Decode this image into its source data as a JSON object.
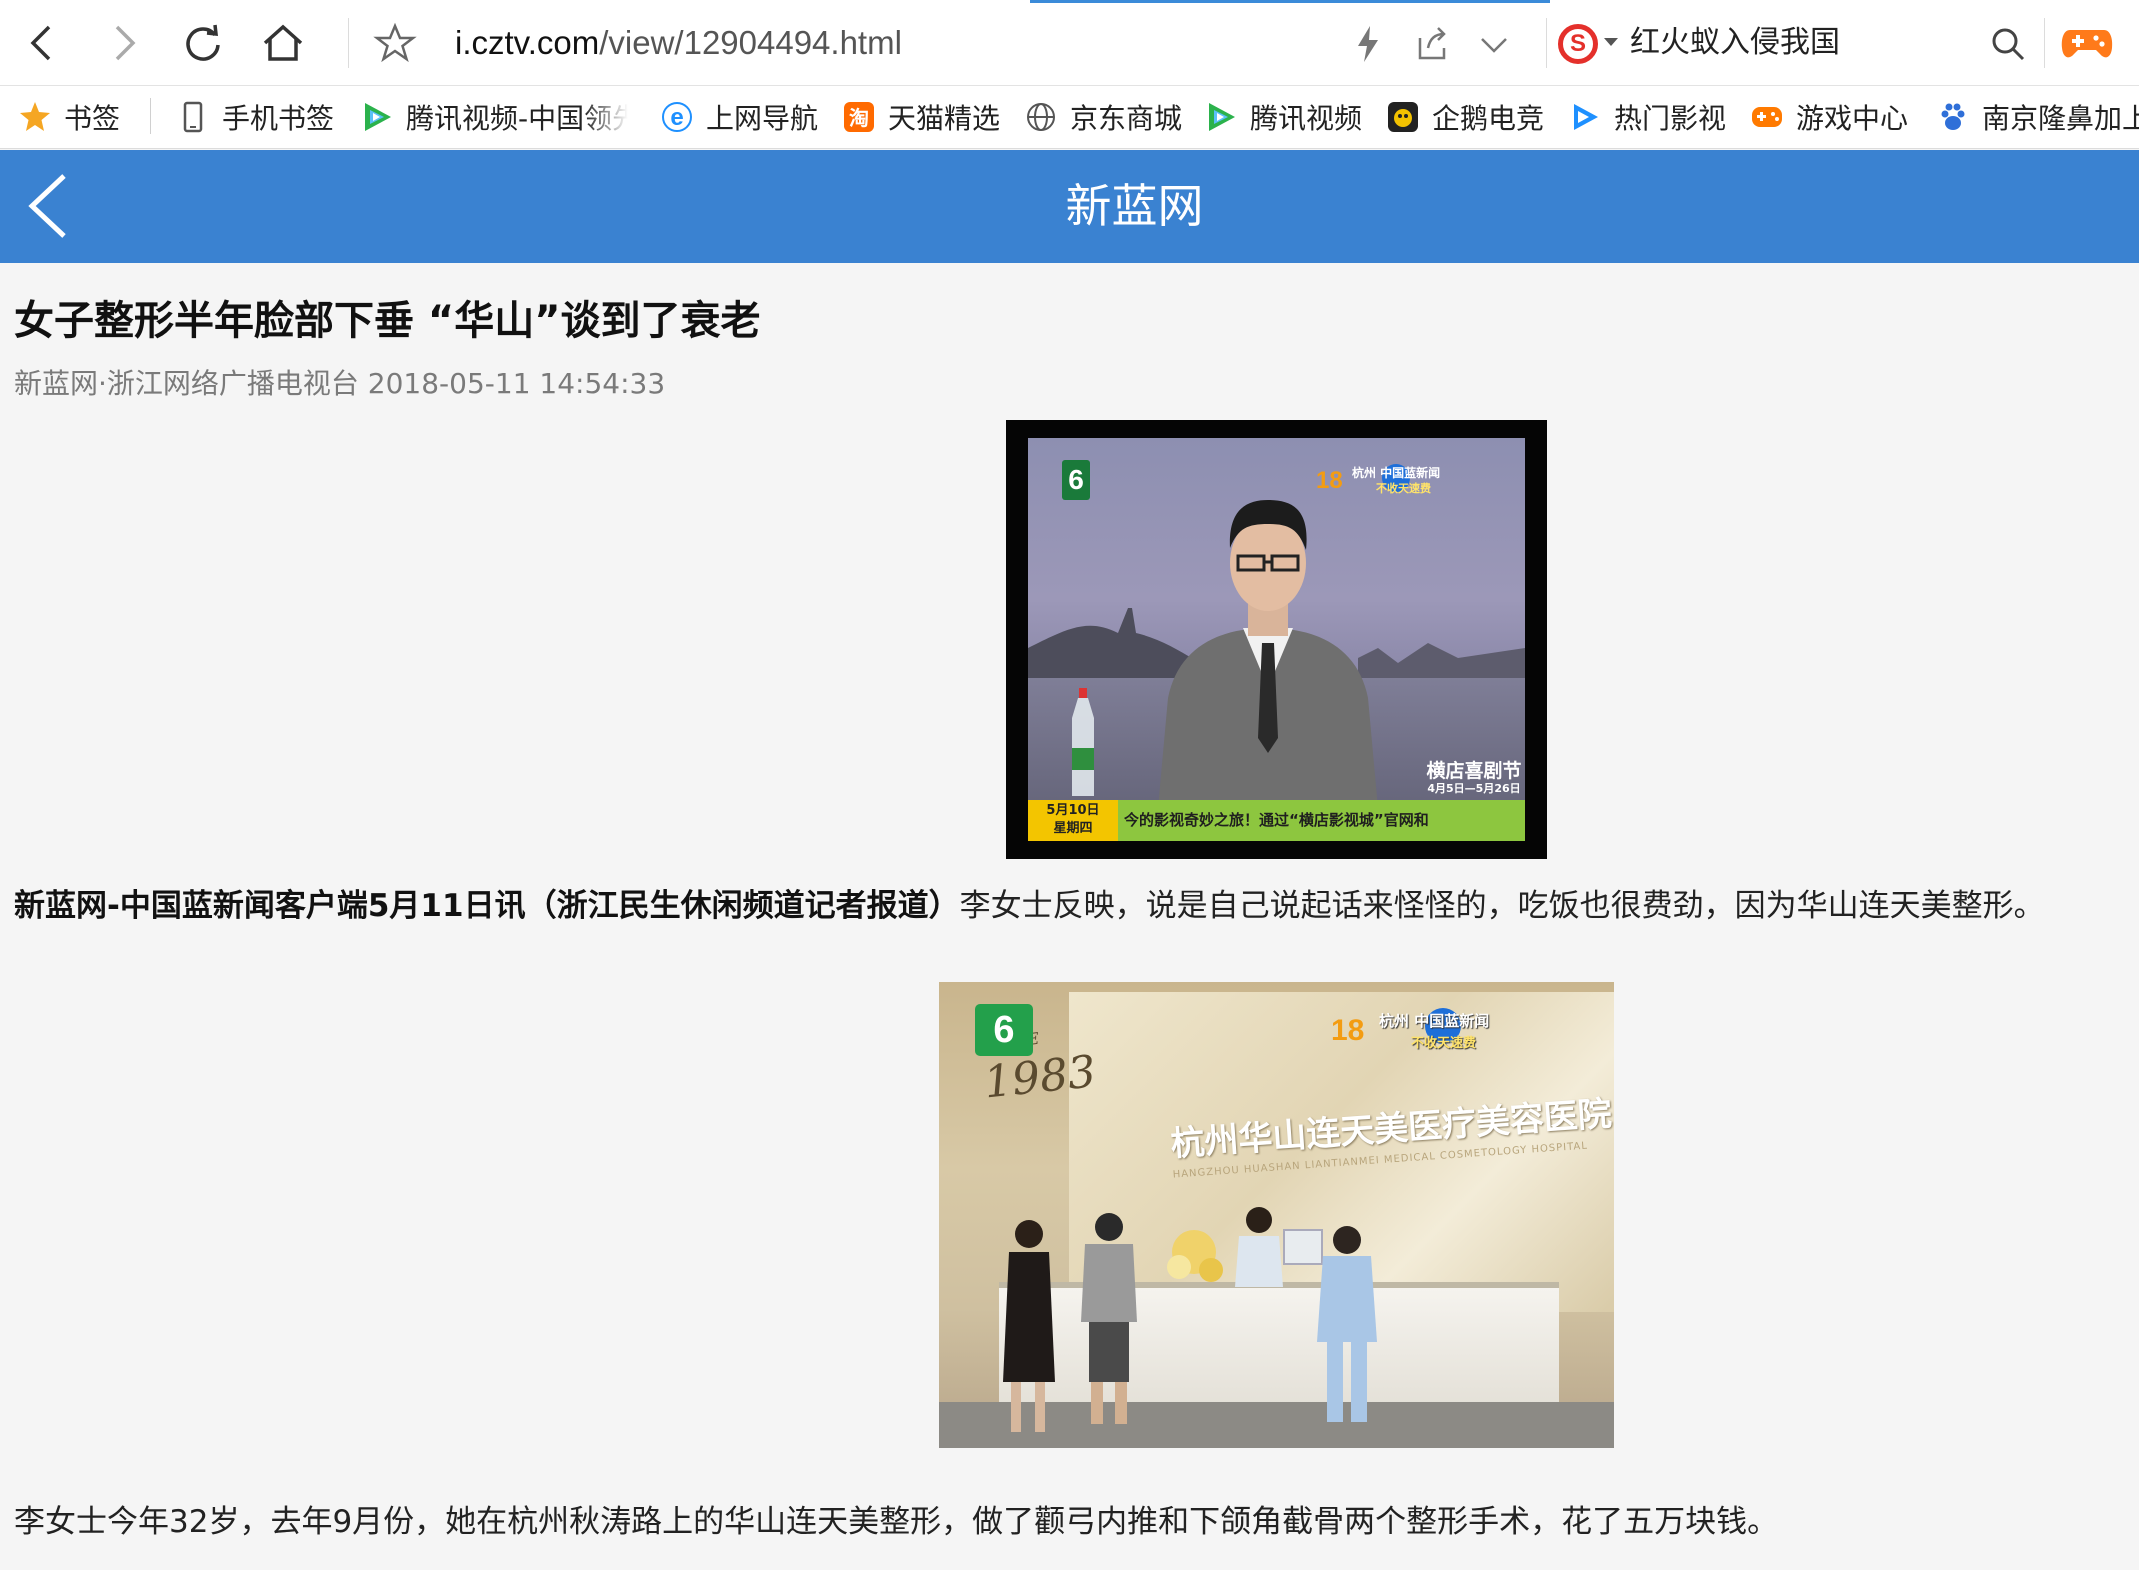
{
  "browser": {
    "url_host": "i.cztv.com",
    "url_path": "/view/12904494.html",
    "search_text": "红火蚁入侵我国",
    "search_engine_icon": "sogou-icon"
  },
  "bookmarks": [
    {
      "label": "书签",
      "icon": "star-icon",
      "color": "#f5a623"
    },
    {
      "label": "手机书签",
      "icon": "phone-icon",
      "color": "#555555"
    },
    {
      "label": "腾讯视频-中国领先",
      "icon": "tencent-video-icon",
      "color": "#2bb24c"
    },
    {
      "label": "上网导航",
      "icon": "ie-icon",
      "color": "#1e90ff"
    },
    {
      "label": "天猫精选",
      "icon": "tmall-icon",
      "color": "#ff6a00"
    },
    {
      "label": "京东商城",
      "icon": "globe-icon",
      "color": "#555555"
    },
    {
      "label": "腾讯视频",
      "icon": "tencent-video-icon",
      "color": "#2bb24c"
    },
    {
      "label": "企鹅电竞",
      "icon": "penguin-esports-icon",
      "color": "#222222"
    },
    {
      "label": "热门影视",
      "icon": "video-play-icon",
      "color": "#1e90ff"
    },
    {
      "label": "游戏中心",
      "icon": "gamepad-icon",
      "color": "#ff7a00"
    },
    {
      "label": "南京隆鼻加上",
      "icon": "baidu-paw-icon",
      "color": "#2f6fd8"
    }
  ],
  "site": {
    "title": "新蓝网",
    "header_color": "#3a82d1"
  },
  "article": {
    "headline": "女子整形半年脸部下垂 “华山”谈到了衰老",
    "meta": "新蓝网·浙江网络广播电视台 2018-05-11 14:54:33",
    "p1_bold": "新蓝网-中国蓝新闻客户端5月11日讯（浙江民生休闲频道记者报道）",
    "p1_text": "李女士反映，说是自己说起话来怪怪的，吃饭也很费劲，因为华山连天美整形。",
    "p2_text": "李女士今年32岁，去年9月份，她在杭州秋涛路上的华山连天美整形，做了颧弓内推和下颌角截骨两个整形手术，花了五万块钱。"
  },
  "image1": {
    "channel_badge": "6",
    "station_logo": "杭州 中国蓝新闻",
    "station_sub": "不收天速费",
    "promo_title": "横店喜剧节",
    "promo_dates": "4月5日—5月26日",
    "ticker_date": "5月10日",
    "ticker_weekday": "星期四",
    "ticker_text": "今的影视奇妙之旅！通过“横店影视城”官网和"
  },
  "image2": {
    "channel_badge": "6",
    "since_label": "SINCE",
    "since_year": "1983",
    "station_logo": "杭州 中国蓝新闻",
    "station_sub": "不收天速费",
    "sign_text": "杭州华山连天美医疗美容医院",
    "sign_en": "HANGZHOU HUASHAN LIANTIANMEI MEDICAL COSMETOLOGY HOSPITAL"
  }
}
